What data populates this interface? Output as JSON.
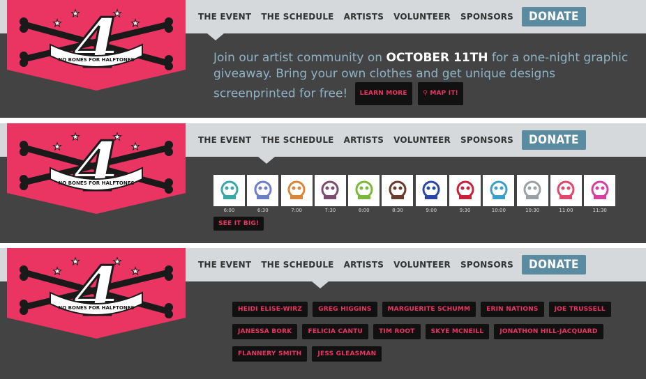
{
  "logo": {
    "number": "4",
    "ribbon_text": "NO BONES FOR HALFTONES"
  },
  "nav": {
    "items": [
      "THE EVENT",
      "THE SCHEDULE",
      "ARTISTS",
      "VOLUNTEER",
      "SPONSORS"
    ],
    "donate": "DONATE"
  },
  "event": {
    "text_before": "Join our artist community on ",
    "date": "OCTOBER 11TH",
    "text_after": " for a one-night graphic giveaway. Bring your own clothes and get unique designs screenprinted for free!",
    "learn_more": "LEARN MORE",
    "map_it": "MAP IT!"
  },
  "schedule": {
    "times": [
      "6:00",
      "6:30",
      "7:00",
      "7:30",
      "8:00",
      "8:30",
      "9:00",
      "9:30",
      "10:00",
      "10:30",
      "11:00",
      "11:30"
    ],
    "colors": [
      "#3aa7a8",
      "#6c7fc6",
      "#d9863a",
      "#7e4b6e",
      "#7bb83a",
      "#6a3a2a",
      "#2a47a6",
      "#c8203a",
      "#3d9ec9",
      "#9aa0a8",
      "#e0486a",
      "#d63ea0"
    ],
    "see_it_big": "SEE IT BIG!"
  },
  "artists": {
    "rows": [
      [
        "HEIDI ELISE-WIRZ",
        "GREG HIGGINS",
        "MARGUERITE SCHUMM",
        "ERIN NATIONS",
        "JOE TRUSSELL"
      ],
      [
        "JANESSA BORK",
        "FELICIA CANTU",
        "TIM ROOT",
        "SKYE MCNEILL",
        "JONATHON HILL-JACQUARD"
      ],
      [
        "FLANNERY SMITH",
        "JESS GLEASMAN"
      ]
    ]
  },
  "colors": {
    "accent": "#ea3462",
    "nav_bg": "#d6d9db",
    "panel_bg": "#434343",
    "donate_bg": "#5b8ba0",
    "intro_text": "#8fb3c6"
  }
}
